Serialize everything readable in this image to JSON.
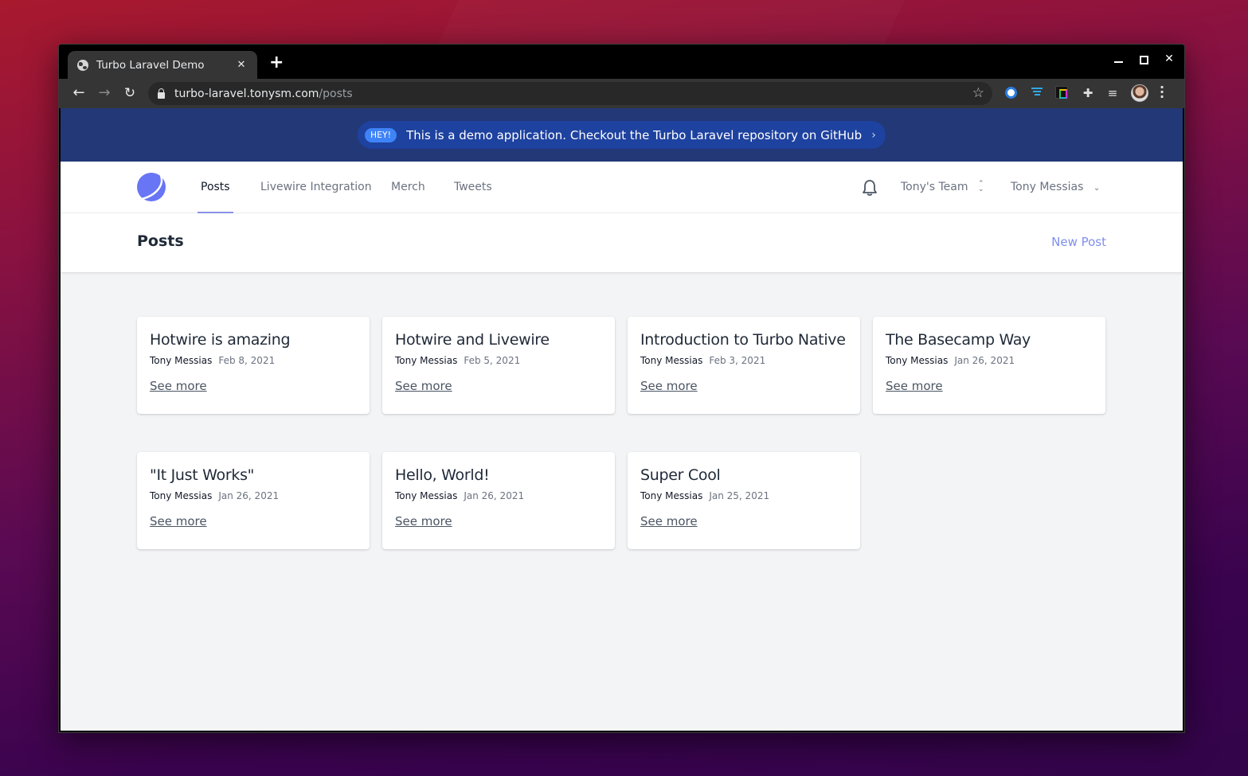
{
  "browser": {
    "tab_title": "Turbo Laravel Demo",
    "tab_icon": "globe-icon",
    "new_tab_label": "+",
    "url_host": "turbo-laravel.tonysm.com",
    "url_path": "/posts",
    "window_controls": [
      "minimize",
      "maximize",
      "close"
    ],
    "extensions": [
      "password-manager-icon",
      "filter-extension-icon",
      "color-extension-icon",
      "puzzle-extensions-icon",
      "media-playlist-icon"
    ],
    "menu_label": "⋮"
  },
  "banner": {
    "badge": "HEY!",
    "text": "This is a demo application. Checkout the Turbo Laravel repository on GitHub",
    "chevron": "›"
  },
  "navbar": {
    "links": [
      {
        "label": "Posts",
        "active": true
      },
      {
        "label": "Livewire Integration",
        "active": false
      },
      {
        "label": "Merch",
        "active": false
      },
      {
        "label": "Tweets",
        "active": false
      }
    ],
    "team_label": "Tony's Team",
    "user_label": "Tony Messias",
    "brand_color": "#6875f5"
  },
  "header": {
    "title": "Posts",
    "new_post_label": "New Post"
  },
  "posts": [
    {
      "title": "Hotwire is amazing",
      "author": "Tony Messias",
      "date": "Feb 8, 2021",
      "link": "See more"
    },
    {
      "title": "Hotwire and Livewire",
      "author": "Tony Messias",
      "date": "Feb 5, 2021",
      "link": "See more"
    },
    {
      "title": "Introduction to Turbo Native",
      "author": "Tony Messias",
      "date": "Feb 3, 2021",
      "link": "See more"
    },
    {
      "title": "The Basecamp Way",
      "author": "Tony Messias",
      "date": "Jan 26, 2021",
      "link": "See more"
    },
    {
      "title": "\"It Just Works\"",
      "author": "Tony Messias",
      "date": "Jan 26, 2021",
      "link": "See more"
    },
    {
      "title": "Hello, World!",
      "author": "Tony Messias",
      "date": "Jan 26, 2021",
      "link": "See more"
    },
    {
      "title": "Super Cool",
      "author": "Tony Messias",
      "date": "Jan 25, 2021",
      "link": "See more"
    }
  ]
}
